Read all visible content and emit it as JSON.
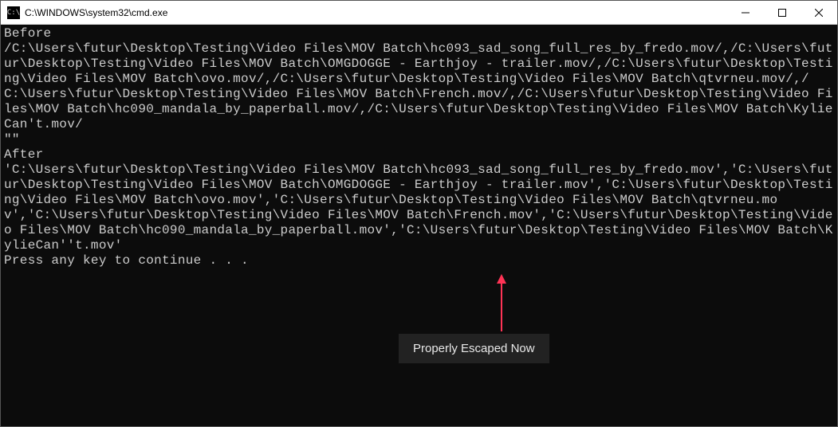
{
  "window": {
    "title": "C:\\WINDOWS\\system32\\cmd.exe",
    "icon_glyph": "C:\\"
  },
  "terminal": {
    "lines": "Before\n/C:\\Users\\futur\\Desktop\\Testing\\Video Files\\MOV Batch\\hc093_sad_song_full_res_by_fredo.mov/,/C:\\Users\\futur\\Desktop\\Testing\\Video Files\\MOV Batch\\OMGDOGGE - Earthjoy - trailer.mov/,/C:\\Users\\futur\\Desktop\\Testing\\Video Files\\MOV Batch\\ovo.mov/,/C:\\Users\\futur\\Desktop\\Testing\\Video Files\\MOV Batch\\qtvrneu.mov/,/C:\\Users\\futur\\Desktop\\Testing\\Video Files\\MOV Batch\\French.mov/,/C:\\Users\\futur\\Desktop\\Testing\\Video Files\\MOV Batch\\hc090_mandala_by_paperball.mov/,/C:\\Users\\futur\\Desktop\\Testing\\Video Files\\MOV Batch\\KylieCan't.mov/\n\"\"\nAfter\n'C:\\Users\\futur\\Desktop\\Testing\\Video Files\\MOV Batch\\hc093_sad_song_full_res_by_fredo.mov','C:\\Users\\futur\\Desktop\\Testing\\Video Files\\MOV Batch\\OMGDOGGE - Earthjoy - trailer.mov','C:\\Users\\futur\\Desktop\\Testing\\Video Files\\MOV Batch\\ovo.mov','C:\\Users\\futur\\Desktop\\Testing\\Video Files\\MOV Batch\\qtvrneu.mov','C:\\Users\\futur\\Desktop\\Testing\\Video Files\\MOV Batch\\French.mov','C:\\Users\\futur\\Desktop\\Testing\\Video Files\\MOV Batch\\hc090_mandala_by_paperball.mov','C:\\Users\\futur\\Desktop\\Testing\\Video Files\\MOV Batch\\KylieCan''t.mov'\nPress any key to continue . . ."
  },
  "annotation": {
    "label": "Properly Escaped Now",
    "arrow_color": "#ff3355"
  }
}
